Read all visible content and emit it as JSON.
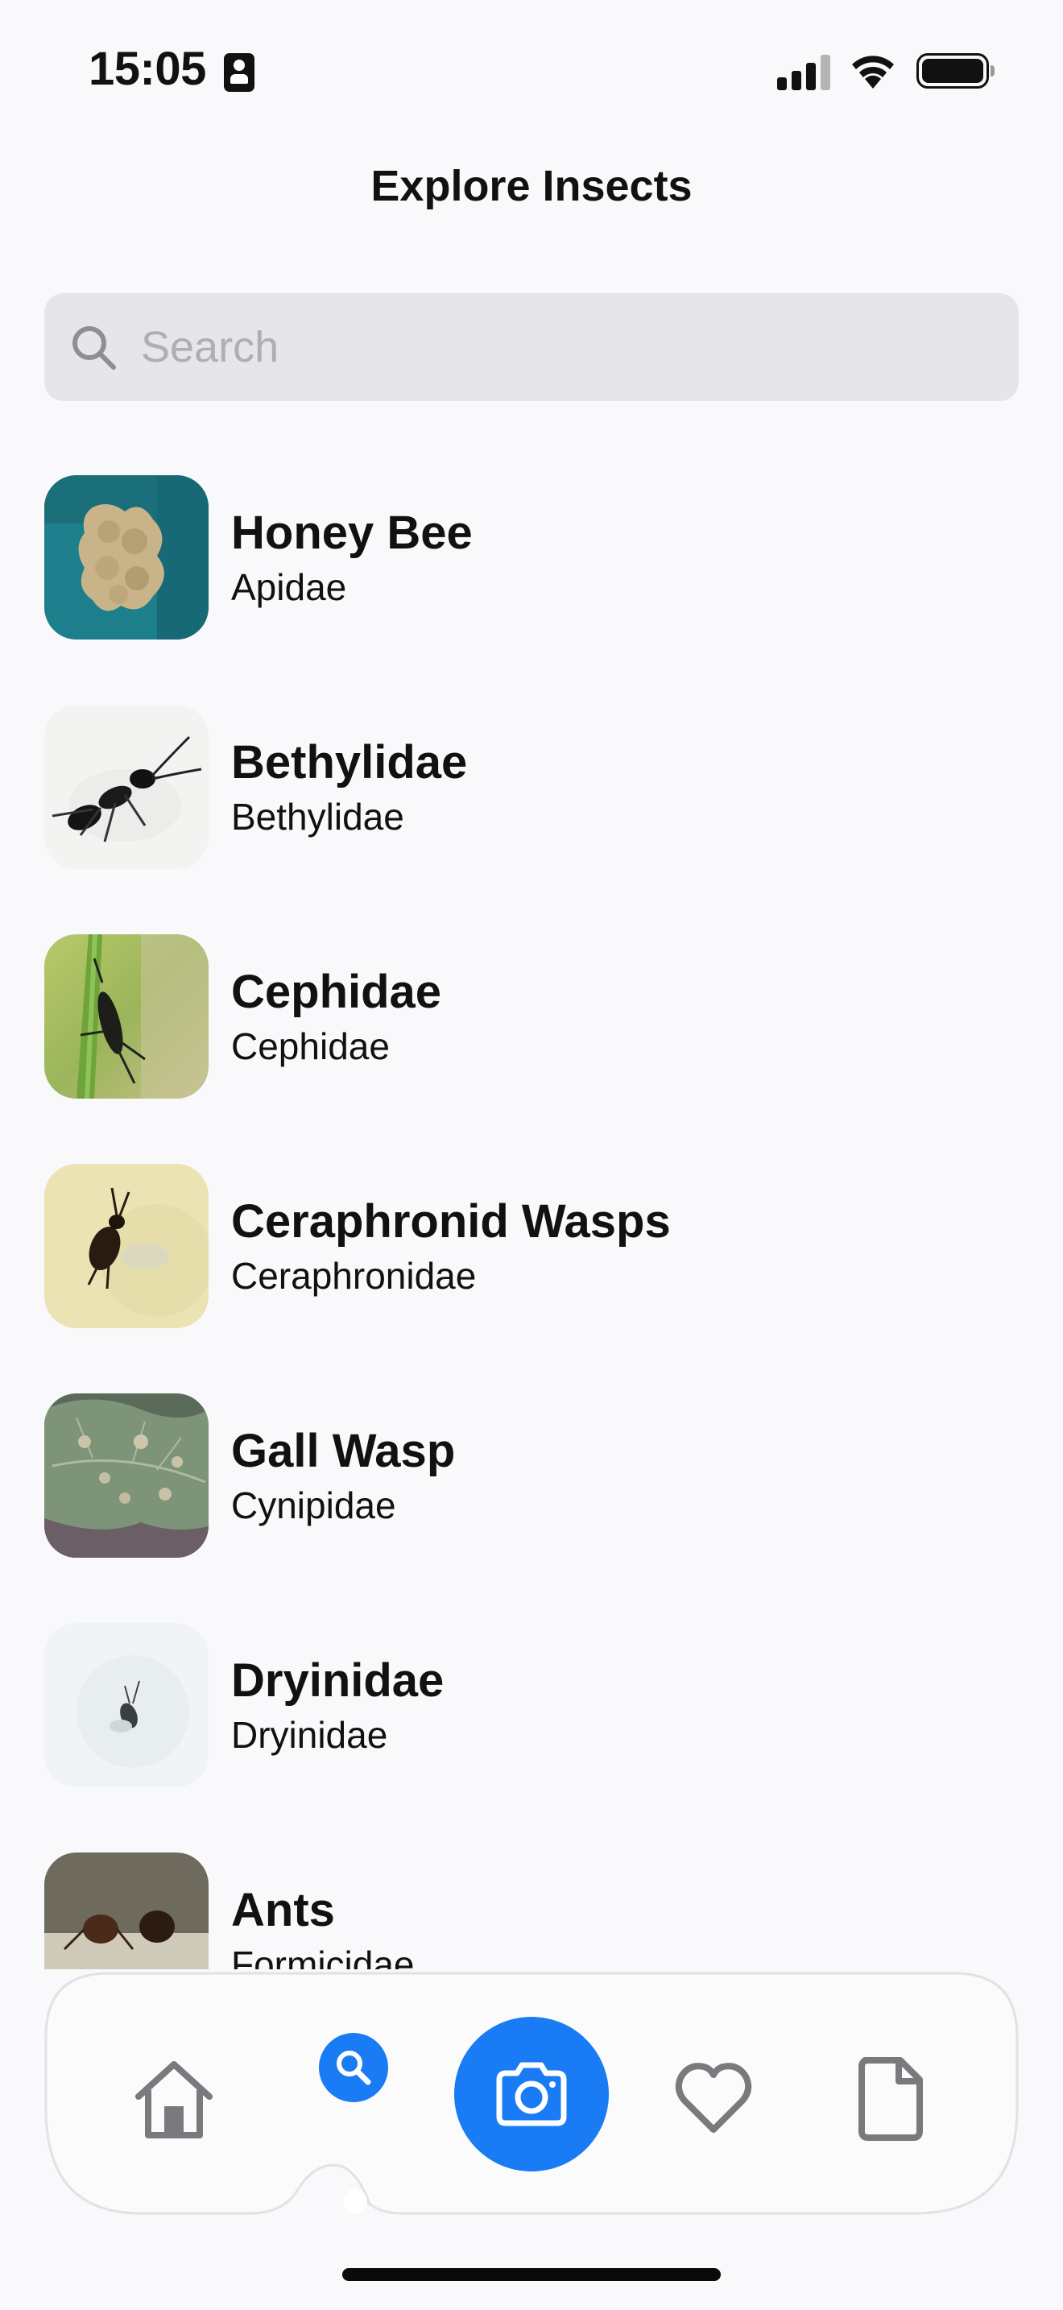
{
  "status_bar": {
    "time": "15:05"
  },
  "header": {
    "title": "Explore Insects"
  },
  "search": {
    "placeholder": "Search",
    "value": ""
  },
  "insects": [
    {
      "name": "Honey Bee",
      "family": "Apidae",
      "icon": "honey-bee-photo"
    },
    {
      "name": "Bethylidae",
      "family": "Bethylidae",
      "icon": "bethylidae-photo"
    },
    {
      "name": "Cephidae",
      "family": "Cephidae",
      "icon": "cephidae-photo"
    },
    {
      "name": "Ceraphronid Wasps",
      "family": "Ceraphronidae",
      "icon": "ceraphronid-photo"
    },
    {
      "name": "Gall Wasp",
      "family": "Cynipidae",
      "icon": "gall-wasp-photo"
    },
    {
      "name": "Dryinidae",
      "family": "Dryinidae",
      "icon": "dryinidae-photo"
    },
    {
      "name": "Ants",
      "family": "Formicidae",
      "icon": "ants-photo"
    }
  ],
  "tab_bar": {
    "items": [
      {
        "id": "home",
        "icon": "home-icon"
      },
      {
        "id": "explore",
        "icon": "search-icon",
        "active": true
      },
      {
        "id": "camera",
        "icon": "camera-icon"
      },
      {
        "id": "favorites",
        "icon": "heart-icon"
      },
      {
        "id": "documents",
        "icon": "document-icon"
      }
    ]
  },
  "colors": {
    "accent": "#1a7cf5",
    "background": "#f9f9fb",
    "search_background": "#e6e6e9",
    "placeholder": "#aeaeb3",
    "tab_icon": "#7a7a7e"
  }
}
